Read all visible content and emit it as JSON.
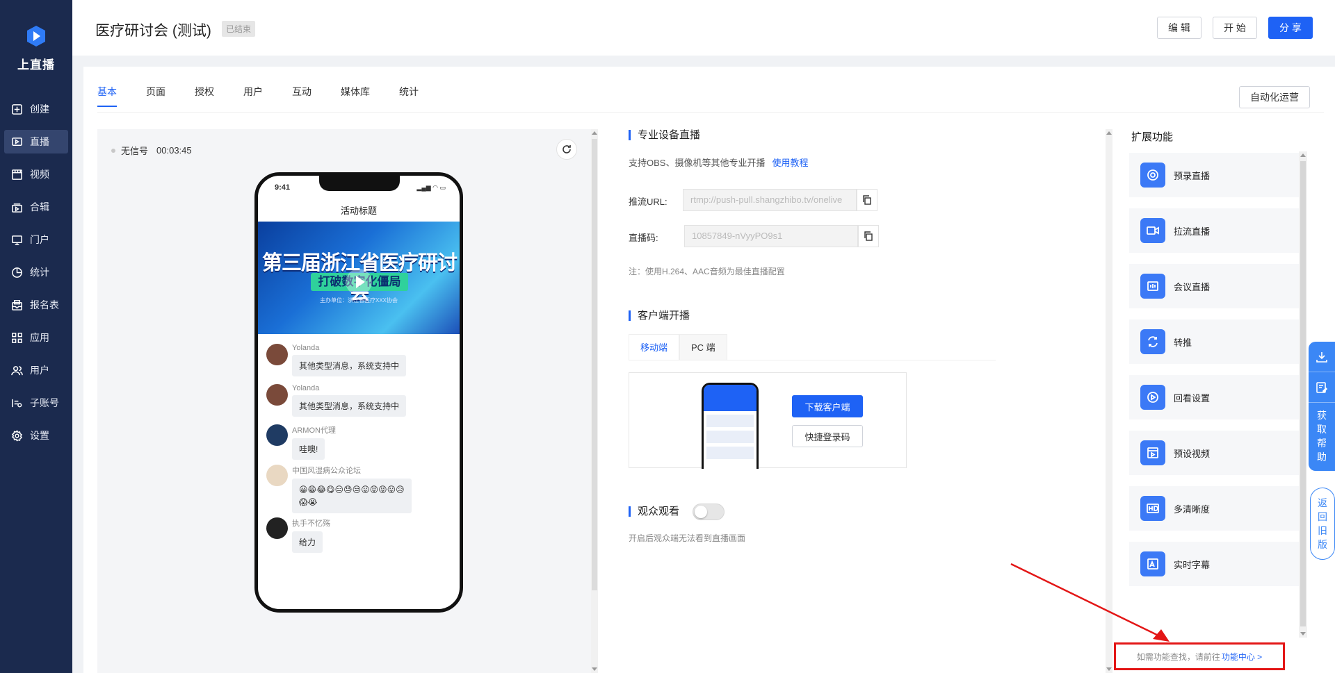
{
  "app": {
    "brand": "上直播",
    "accent": "#1e62f5",
    "sidebar_bg": "#1b2a4e"
  },
  "sidebar": {
    "items": [
      {
        "label": "创建",
        "icon": "plus-square-icon"
      },
      {
        "label": "直播",
        "icon": "video-icon",
        "active": true
      },
      {
        "label": "视频",
        "icon": "film-icon"
      },
      {
        "label": "合辑",
        "icon": "collection-icon"
      },
      {
        "label": "门户",
        "icon": "monitor-icon"
      },
      {
        "label": "统计",
        "icon": "pie-chart-icon"
      },
      {
        "label": "报名表",
        "icon": "form-icon"
      },
      {
        "label": "应用",
        "icon": "apps-icon"
      },
      {
        "label": "用户",
        "icon": "users-icon"
      },
      {
        "label": "子账号",
        "icon": "sub-account-icon"
      },
      {
        "label": "设置",
        "icon": "gear-icon"
      }
    ]
  },
  "header": {
    "title": "医疗研讨会 (测试)",
    "status": "已结束",
    "edit_label": "编 辑",
    "start_label": "开 始",
    "share_label": "分 享"
  },
  "tabs": [
    "基本",
    "页面",
    "授权",
    "用户",
    "互动",
    "媒体库",
    "统计"
  ],
  "active_tab": "基本",
  "auto_ops_label": "自动化运营",
  "preview": {
    "signal": "无信号",
    "duration": "00:03:45",
    "phone": {
      "time": "9:41",
      "activity_title": "活动标题",
      "banner_line1": "第三届浙江省医疗研讨会",
      "banner_line2": "打破数字化僵局",
      "banner_line3": "主办单位：浙江省医疗XXX协会",
      "messages": [
        {
          "name": "Yolanda",
          "text": "其他类型消息，系统支持中",
          "avatar_color": "#7a4a3a"
        },
        {
          "name": "Yolanda",
          "text": "其他类型消息，系统支持中",
          "avatar_color": "#7a4a3a"
        },
        {
          "name": "ARMON代理",
          "text": "哇噢!",
          "avatar_color": "#1f3b63"
        },
        {
          "name": "中国风湿病公众论坛",
          "text": "😀😁😂😋😑😓😒😛😝😝😛😥😱😭",
          "avatar_color": "#e9d8c2"
        },
        {
          "name": "执手不忆殇",
          "text": "给力",
          "avatar_color": "#222"
        }
      ]
    }
  },
  "pro_device": {
    "title": "专业设备直播",
    "desc": "支持OBS、摄像机等其他专业开播",
    "tutorial_link": "使用教程",
    "push_url_label": "推流URL:",
    "push_url_value": "rtmp://push-pull.shangzhibo.tv/onelive",
    "code_label": "直播码:",
    "code_value": "10857849-nVyyPO9s1",
    "note": "注：使用H.264、AAC音频为最佳直播配置"
  },
  "client": {
    "title": "客户端开播",
    "tabs": [
      "移动端",
      "PC 端"
    ],
    "download_label": "下载客户端",
    "quick_login_label": "快捷登录码"
  },
  "audience": {
    "title": "观众观看",
    "desc": "开启后观众端无法看到直播画面",
    "enabled": false
  },
  "extensions": {
    "title": "扩展功能",
    "items": [
      {
        "label": "预录直播",
        "icon": "record-icon"
      },
      {
        "label": "拉流直播",
        "icon": "camera-icon"
      },
      {
        "label": "会议直播",
        "icon": "meeting-icon"
      },
      {
        "label": "转推",
        "icon": "repush-icon"
      },
      {
        "label": "回看设置",
        "icon": "playback-icon"
      },
      {
        "label": "预设视频",
        "icon": "preset-video-icon"
      },
      {
        "label": "多清晰度",
        "icon": "hd-icon"
      },
      {
        "label": "实时字幕",
        "icon": "subtitle-icon"
      }
    ],
    "note_prefix": "如需功能查找，请前往",
    "note_link": "功能中心 >"
  },
  "float": {
    "help_label": "获取帮助",
    "back_old_label": "返回旧版"
  }
}
